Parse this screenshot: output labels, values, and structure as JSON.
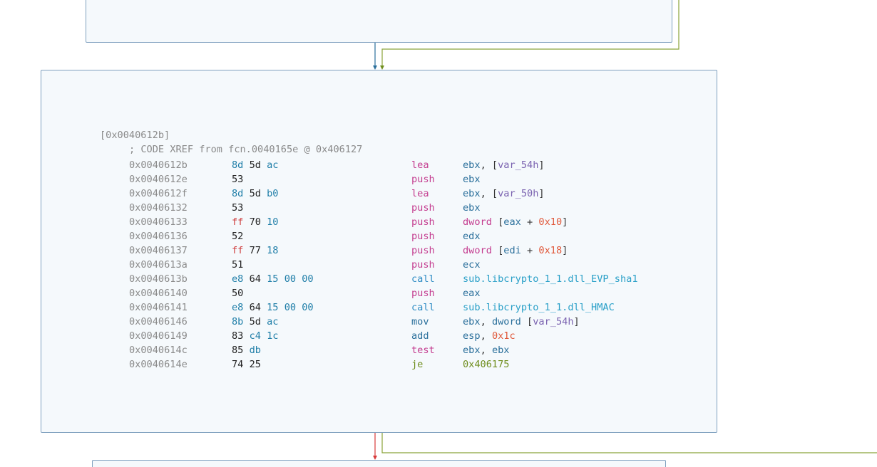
{
  "block": {
    "label": "[0x0040612b]",
    "xref": "; CODE XREF from fcn.0040165e @ 0x406127"
  },
  "rows": [
    {
      "addr": "0x0040612b",
      "bytes": [
        [
          "8d",
          "hi"
        ],
        [
          "5d",
          "lo"
        ],
        [
          "ac",
          "hi"
        ]
      ],
      "mn": "lea",
      "mn_kind": "plain",
      "ops": [
        [
          "ebx",
          "reg"
        ],
        [
          ", [",
          "punc"
        ],
        [
          "var_54h",
          "var"
        ],
        [
          "]",
          "punc"
        ]
      ]
    },
    {
      "addr": "0x0040612e",
      "bytes": [
        [
          "53",
          "lo"
        ]
      ],
      "mn": "push",
      "mn_kind": "plain",
      "ops": [
        [
          "ebx",
          "reg"
        ]
      ]
    },
    {
      "addr": "0x0040612f",
      "bytes": [
        [
          "8d",
          "hi"
        ],
        [
          "5d",
          "lo"
        ],
        [
          "b0",
          "hi"
        ]
      ],
      "mn": "lea",
      "mn_kind": "plain",
      "ops": [
        [
          "ebx",
          "reg"
        ],
        [
          ", [",
          "punc"
        ],
        [
          "var_50h",
          "var"
        ],
        [
          "]",
          "punc"
        ]
      ]
    },
    {
      "addr": "0x00406132",
      "bytes": [
        [
          "53",
          "lo"
        ]
      ],
      "mn": "push",
      "mn_kind": "plain",
      "ops": [
        [
          "ebx",
          "reg"
        ]
      ]
    },
    {
      "addr": "0x00406133",
      "bytes": [
        [
          "ff",
          "ff"
        ],
        [
          "70",
          "lo"
        ],
        [
          "10",
          "hi"
        ]
      ],
      "mn": "push",
      "mn_kind": "plain",
      "ops": [
        [
          "dword",
          "kw"
        ],
        [
          " [",
          "punc"
        ],
        [
          "eax",
          "reg"
        ],
        [
          " + ",
          "punc"
        ],
        [
          "0x10",
          "num"
        ],
        [
          "]",
          "punc"
        ]
      ]
    },
    {
      "addr": "0x00406136",
      "bytes": [
        [
          "52",
          "lo"
        ]
      ],
      "mn": "push",
      "mn_kind": "plain",
      "ops": [
        [
          "edx",
          "reg"
        ]
      ]
    },
    {
      "addr": "0x00406137",
      "bytes": [
        [
          "ff",
          "ff"
        ],
        [
          "77",
          "lo"
        ],
        [
          "18",
          "hi"
        ]
      ],
      "mn": "push",
      "mn_kind": "plain",
      "ops": [
        [
          "dword",
          "kw"
        ],
        [
          " [",
          "punc"
        ],
        [
          "edi",
          "reg"
        ],
        [
          " + ",
          "punc"
        ],
        [
          "0x18",
          "num"
        ],
        [
          "]",
          "punc"
        ]
      ]
    },
    {
      "addr": "0x0040613a",
      "bytes": [
        [
          "51",
          "lo"
        ]
      ],
      "mn": "push",
      "mn_kind": "plain",
      "ops": [
        [
          "ecx",
          "reg"
        ]
      ]
    },
    {
      "addr": "0x0040613b",
      "bytes": [
        [
          "e8",
          "hi"
        ],
        [
          "64",
          "lo"
        ],
        [
          "15",
          "hi"
        ],
        [
          "00",
          "hi"
        ],
        [
          "00",
          "hi"
        ]
      ],
      "mn": "call",
      "mn_kind": "call",
      "ops": [
        [
          "sub.libcrypto_1_1.dll_EVP_sha1",
          "sym"
        ]
      ]
    },
    {
      "addr": "0x00406140",
      "bytes": [
        [
          "50",
          "lo"
        ]
      ],
      "mn": "push",
      "mn_kind": "plain",
      "ops": [
        [
          "eax",
          "reg"
        ]
      ]
    },
    {
      "addr": "0x00406141",
      "bytes": [
        [
          "e8",
          "hi"
        ],
        [
          "64",
          "lo"
        ],
        [
          "15",
          "hi"
        ],
        [
          "00",
          "hi"
        ],
        [
          "00",
          "hi"
        ]
      ],
      "mn": "call",
      "mn_kind": "call",
      "ops": [
        [
          "sub.libcrypto_1_1.dll_HMAC",
          "sym"
        ]
      ]
    },
    {
      "addr": "0x00406146",
      "bytes": [
        [
          "8b",
          "hi"
        ],
        [
          "5d",
          "lo"
        ],
        [
          "ac",
          "hi"
        ]
      ],
      "mn": "mov",
      "mn_kind": "arith",
      "ops": [
        [
          "ebx",
          "reg"
        ],
        [
          ", ",
          "punc"
        ],
        [
          "dword",
          "reg"
        ],
        [
          " [",
          "punc"
        ],
        [
          "var_54h",
          "var"
        ],
        [
          "]",
          "punc"
        ]
      ]
    },
    {
      "addr": "0x00406149",
      "bytes": [
        [
          "83",
          "lo"
        ],
        [
          "c4",
          "hi"
        ],
        [
          "1c",
          "hi"
        ]
      ],
      "mn": "add",
      "mn_kind": "arith",
      "ops": [
        [
          "esp",
          "reg"
        ],
        [
          ", ",
          "punc"
        ],
        [
          "0x1c",
          "num"
        ]
      ]
    },
    {
      "addr": "0x0040614c",
      "bytes": [
        [
          "85",
          "lo"
        ],
        [
          "db",
          "hi"
        ]
      ],
      "mn": "test",
      "mn_kind": "plain",
      "ops": [
        [
          "ebx",
          "reg"
        ],
        [
          ", ",
          "punc"
        ],
        [
          "ebx",
          "reg"
        ]
      ]
    },
    {
      "addr": "0x0040614e",
      "bytes": [
        [
          "74",
          "lo"
        ],
        [
          "25",
          "lo"
        ]
      ],
      "mn": "je",
      "mn_kind": "jmp",
      "ops": [
        [
          "0x406175",
          "addr"
        ]
      ]
    }
  ],
  "colors": {
    "edge_true": "#6f8e1e",
    "edge_false": "#d83a3a",
    "edge_uncond": "#2a6f9b",
    "node_border": "#7fa0bf",
    "node_bg": "#f5f9fc"
  }
}
